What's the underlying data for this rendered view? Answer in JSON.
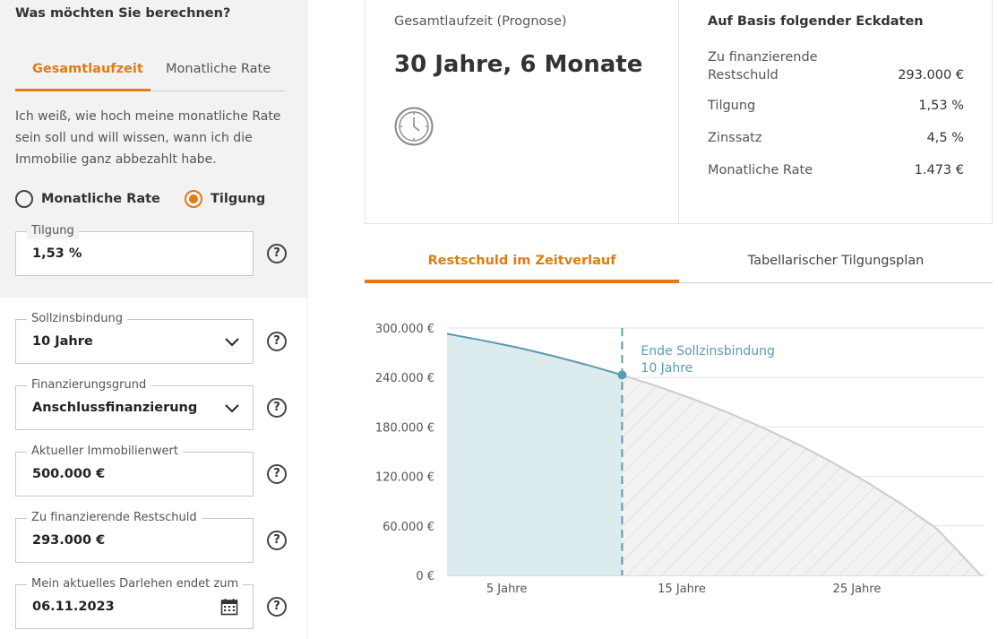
{
  "left": {
    "question": "Was möchten Sie berechnen?",
    "tabs": [
      {
        "label": "Gesamtlaufzeit",
        "active": true
      },
      {
        "label": "Monatliche Rate",
        "active": false
      }
    ],
    "description_lines": [
      "Ich weiß, wie hoch meine monatliche Rate",
      "sein soll und will wissen, wann ich die",
      "Immobilie ganz abbezahlt habe."
    ],
    "radios": [
      {
        "label": "Monatliche Rate",
        "checked": false
      },
      {
        "label": "Tilgung",
        "checked": true
      }
    ],
    "fields": {
      "tilgung": {
        "label": "Tilgung",
        "value": "1,53 %"
      },
      "sollzinsbindung": {
        "label": "Sollzinsbindung",
        "value": "10 Jahre"
      },
      "finanzierungsgrund": {
        "label": "Finanzierungsgrund",
        "value": "Anschlussfinanzierung"
      },
      "immobilienwert": {
        "label": "Aktueller Immobilienwert",
        "value": "500.000 €"
      },
      "restschuld": {
        "label": "Zu finanzierende Restschuld",
        "value": "293.000 €"
      },
      "darlehen_ende": {
        "label": "Mein aktuelles Darlehen endet zum",
        "value": "06.11.2023"
      }
    },
    "help_glyph": "?"
  },
  "result": {
    "duration_label": "Gesamtlaufzeit (Prognose)",
    "duration_value": "30 Jahre, 6 Monate",
    "eckdaten_title": "Auf Basis folgender Eckdaten",
    "eckdaten": [
      {
        "label_line1": "Zu finanzierende",
        "label_line2": "Restschuld",
        "value": "293.000 €"
      },
      {
        "label_line1": "Tilgung",
        "label_line2": "",
        "value": "1,53 %"
      },
      {
        "label_line1": "Zinssatz",
        "label_line2": "",
        "value": "4,5 %"
      },
      {
        "label_line1": "Monatliche Rate",
        "label_line2": "",
        "value": "1.473 €"
      }
    ]
  },
  "chart_tabs": [
    {
      "label": "Restschuld im Zeitverlauf",
      "active": true
    },
    {
      "label": "Tabellarischer Tilgungsplan",
      "active": false
    }
  ],
  "colors": {
    "accent": "#e07b12",
    "area_fixed": "#dbebee",
    "line_fixed": "#5a9bb0",
    "area_after": "#f2f2f2",
    "line_after": "#cccccc"
  },
  "chart_data": {
    "type": "area",
    "ylim": [
      0,
      300000
    ],
    "xlim": [
      0,
      30.5
    ],
    "y_ticks": [
      {
        "value": 300000,
        "label": "300.000 €"
      },
      {
        "value": 240000,
        "label": "240.000 €"
      },
      {
        "value": 180000,
        "label": "180.000 €"
      },
      {
        "value": 120000,
        "label": "120.000 €"
      },
      {
        "value": 60000,
        "label": "60.000 €"
      },
      {
        "value": 0,
        "label": "0 €"
      }
    ],
    "x_ticks": [
      {
        "value": 3,
        "label": "5 Jahre"
      },
      {
        "value": 13,
        "label": "15 Jahre"
      },
      {
        "value": 23,
        "label": "25 Jahre"
      }
    ],
    "annotation": {
      "x": 10,
      "label_line1": "Ende Sollzinsbindung",
      "label_line2": "10 Jahre"
    },
    "series": [
      {
        "values_x": [
          0,
          2,
          4,
          6,
          8,
          10
        ],
        "values_y": [
          293000,
          285100,
          276500,
          266400,
          255300,
          243000
        ]
      },
      {
        "values_x": [
          10,
          12,
          14,
          16,
          18,
          20,
          22,
          24,
          26,
          28,
          30.5
        ],
        "values_y": [
          243000,
          229400,
          214300,
          197800,
          179600,
          159500,
          137300,
          112800,
          85900,
          56200,
          0
        ]
      }
    ]
  }
}
